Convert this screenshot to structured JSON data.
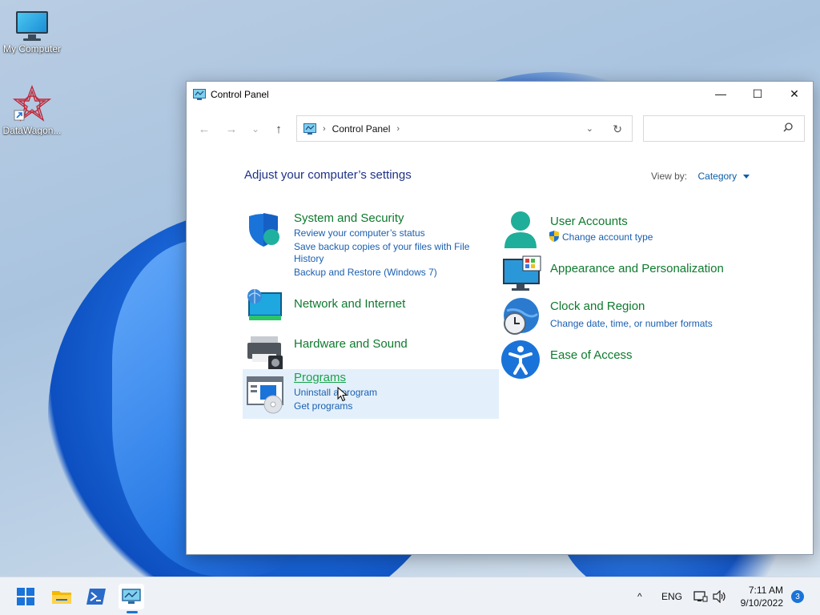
{
  "desktop": {
    "icons": [
      {
        "label": "My Computer",
        "icon": "computer-icon"
      },
      {
        "label": "DataWagon...",
        "icon": "datawagon-icon"
      }
    ]
  },
  "window": {
    "title": "Control Panel",
    "controls": {
      "minimize": "—",
      "maximize": "☐",
      "close": "✕"
    },
    "nav": {
      "back": "←",
      "forward": "→",
      "recent": "⌄",
      "up": "↑"
    },
    "address": {
      "location": "Control Panel",
      "chevron": "›"
    },
    "search": {
      "placeholder": ""
    }
  },
  "content": {
    "heading": "Adjust your computer’s settings",
    "view_by": {
      "label": "View by:",
      "value": "Category"
    },
    "categories": [
      {
        "title": "System and Security",
        "links": [
          "Review your computer’s status",
          "Save backup copies of your files with File",
          "History",
          "Backup and Restore (Windows 7)"
        ]
      },
      {
        "title": "Network and Internet",
        "links": []
      },
      {
        "title": "Hardware and Sound",
        "links": []
      },
      {
        "title": "Programs",
        "links": [
          "Uninstall a program",
          "Get programs"
        ]
      },
      {
        "title": "User Accounts",
        "links": [
          "Change account type"
        ]
      },
      {
        "title": "Appearance and Personalization",
        "links": []
      },
      {
        "title": "Clock and Region",
        "links": [
          "Change date, time, or number formats"
        ]
      },
      {
        "title": "Ease of Access",
        "links": []
      }
    ]
  },
  "taskbar": {
    "items": [
      "start-icon",
      "file-explorer-icon",
      "powershell-icon",
      "control-panel-icon"
    ],
    "tray": {
      "chevron": "^",
      "language": "ENG"
    },
    "clock": {
      "time": "7:11 AM",
      "date": "9/10/2022"
    },
    "notifications": "3"
  },
  "colors": {
    "accent": "#1a73d9",
    "category_title": "#0e7a2e",
    "link": "#1a5fb0",
    "heading": "#1e3287",
    "highlight": "#e3f0fb"
  }
}
